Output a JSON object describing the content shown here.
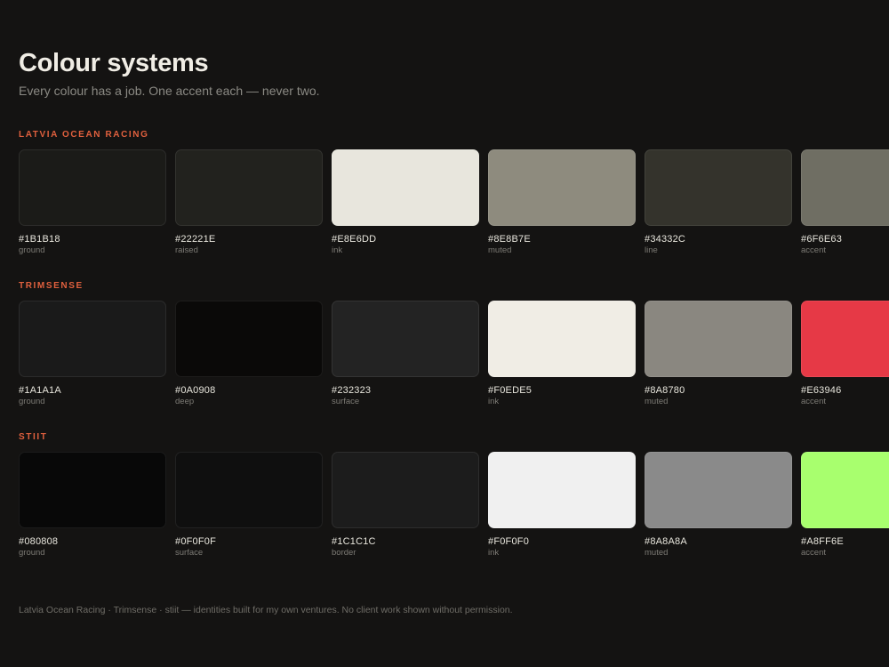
{
  "header": {
    "title": "Colour systems",
    "subtitle": "Every colour has a job. One accent each — never two."
  },
  "systems": [
    {
      "name": "LATVIA OCEAN RACING",
      "accent_color": "#E0603E",
      "swatches": [
        {
          "hex": "#1B1B18",
          "role": "ground",
          "color": "#1B1B18"
        },
        {
          "hex": "#22221E",
          "role": "raised",
          "color": "#22221E"
        },
        {
          "hex": "#E8E6DD",
          "role": "ink",
          "color": "#E8E6DD"
        },
        {
          "hex": "#8E8B7E",
          "role": "muted",
          "color": "#8E8B7E"
        },
        {
          "hex": "#34332C",
          "role": "line",
          "color": "#34332C"
        },
        {
          "hex": "#6F6E63",
          "role": "accent",
          "color": "#6F6E63"
        }
      ]
    },
    {
      "name": "TRIMSENSE",
      "accent_color": "#E0603E",
      "swatches": [
        {
          "hex": "#1A1A1A",
          "role": "ground",
          "color": "#1A1A1A"
        },
        {
          "hex": "#0A0908",
          "role": "deep",
          "color": "#0A0908"
        },
        {
          "hex": "#232323",
          "role": "surface",
          "color": "#232323"
        },
        {
          "hex": "#F0EDE5",
          "role": "ink",
          "color": "#F0EDE5"
        },
        {
          "hex": "#8A8780",
          "role": "muted",
          "color": "#8A8780"
        },
        {
          "hex": "#E63946",
          "role": "accent",
          "color": "#E63946"
        }
      ]
    },
    {
      "name": "STIIT",
      "accent_color": "#E0603E",
      "swatches": [
        {
          "hex": "#080808",
          "role": "ground",
          "color": "#080808"
        },
        {
          "hex": "#0F0F0F",
          "role": "surface",
          "color": "#0F0F0F"
        },
        {
          "hex": "#1C1C1C",
          "role": "border",
          "color": "#1C1C1C"
        },
        {
          "hex": "#F0F0F0",
          "role": "ink",
          "color": "#F0F0F0"
        },
        {
          "hex": "#8A8A8A",
          "role": "muted",
          "color": "#8A8A8A"
        },
        {
          "hex": "#A8FF6E",
          "role": "accent",
          "color": "#A8FF6E"
        }
      ]
    }
  ],
  "footer": {
    "note": "Latvia Ocean Racing · Trimsense · stiit — identities built for my own ventures. No client work shown without permission."
  }
}
